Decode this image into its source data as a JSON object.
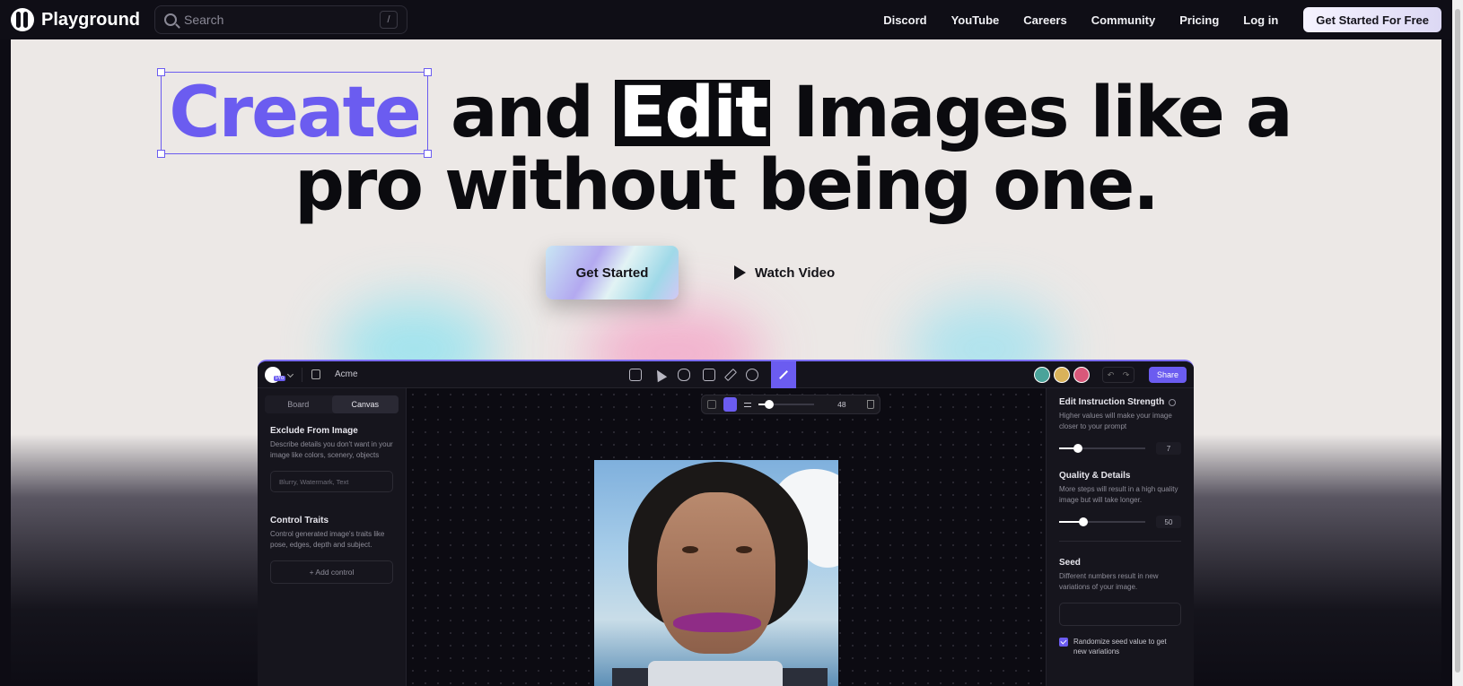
{
  "nav": {
    "brand": "Playground",
    "search_placeholder": "Search",
    "search_shortcut": "/",
    "links": [
      "Discord",
      "YouTube",
      "Careers",
      "Community",
      "Pricing",
      "Log in"
    ],
    "cta": "Get Started For Free"
  },
  "hero": {
    "word_create": "Create",
    "text_and": " and ",
    "word_edit": "Edit",
    "text_rest_line1": " Images like a",
    "line2": "pro without being one.",
    "primary_button": "Get Started",
    "secondary_button": "Watch Video",
    "accent_color": "#6b5cf0"
  },
  "app": {
    "pro_badge": "Pro",
    "project_name": "Acme",
    "share_label": "Share",
    "tabs": [
      "Board",
      "Canvas"
    ],
    "active_tab": "Canvas",
    "brush_size": "48",
    "brush_size_fraction": 0.2,
    "left_panel": {
      "exclude_title": "Exclude From Image",
      "exclude_desc": "Describe details you don't want in your image like colors, scenery, objects",
      "exclude_placeholder": "Blurry, Watermark, Text",
      "control_title": "Control Traits",
      "control_desc": "Control generated image's traits like pose, edges, depth and subject.",
      "add_control": "+ Add control"
    },
    "right_panel": {
      "strength_title": "Edit Instruction Strength",
      "strength_desc": "Higher values will make your image closer to your prompt",
      "strength_value": "7",
      "strength_fraction": 0.22,
      "quality_title": "Quality & Details",
      "quality_desc": "More steps will result in a high quality image but will take longer.",
      "quality_value": "50",
      "quality_fraction": 0.28,
      "seed_title": "Seed",
      "seed_desc": "Different numbers result in new variations of your image.",
      "randomize_label": "Randomize seed value to get new variations",
      "randomize_checked": true
    }
  }
}
